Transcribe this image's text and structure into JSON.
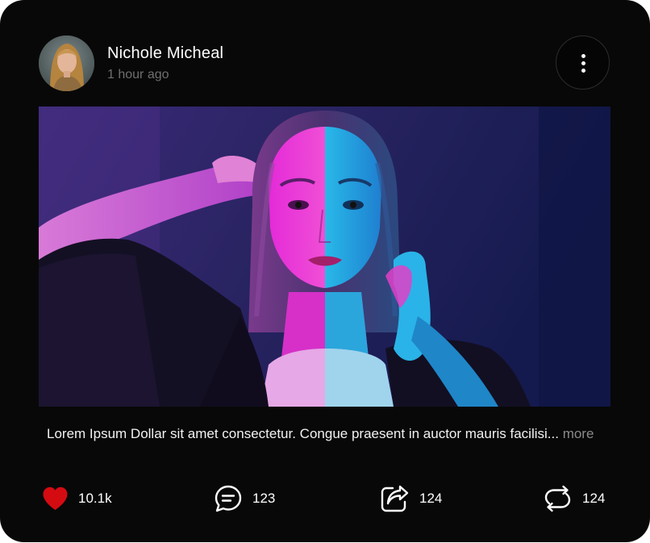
{
  "post": {
    "author": "Nichole Micheal",
    "time": "1 hour ago",
    "caption": "Lorem Ipsum Dollar sit amet consectetur. Congue praesent in auctor mauris facilisi...",
    "more_label": "more"
  },
  "actions": {
    "likes": "10.1k",
    "comments": "123",
    "shares": "124",
    "reposts": "124"
  },
  "icons": {
    "like": "heart-icon",
    "comment": "comment-icon",
    "share": "share-icon",
    "repost": "repost-icon",
    "menu": "more-vertical-icon"
  },
  "colors": {
    "card_background": "#080808",
    "like": "#d50b12",
    "secondary_text": "#6f6f6f"
  }
}
